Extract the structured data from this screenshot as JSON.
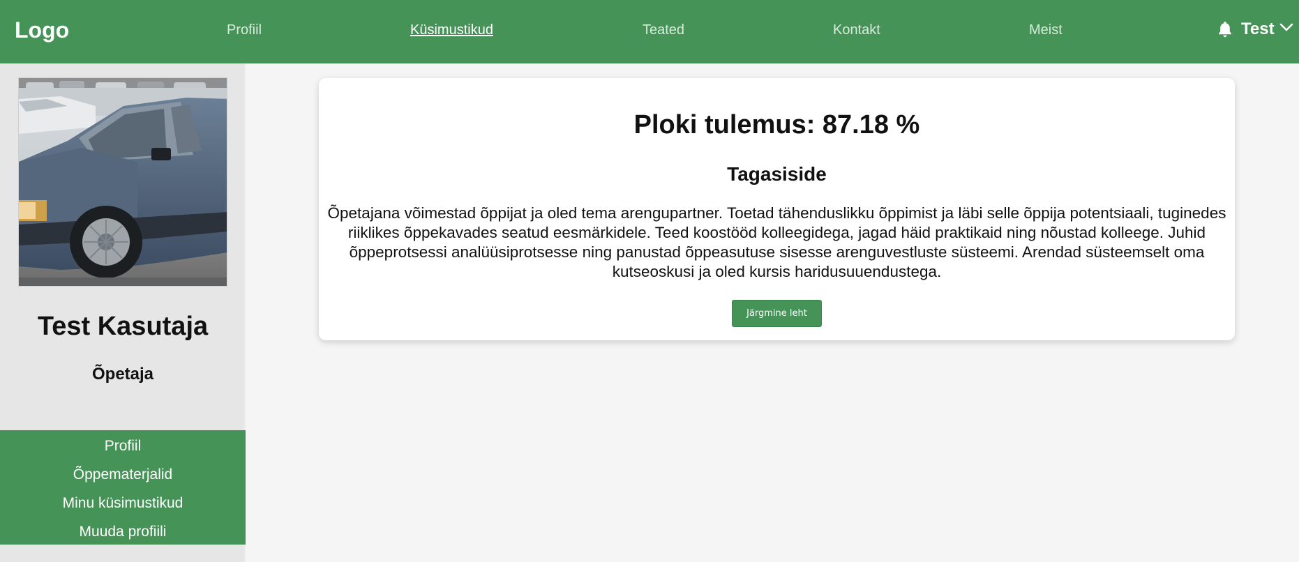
{
  "header": {
    "logo": "Logo",
    "nav": [
      {
        "label": "Profiil",
        "active": false
      },
      {
        "label": "Küsimustikud",
        "active": true
      },
      {
        "label": "Teated",
        "active": false
      },
      {
        "label": "Kontakt",
        "active": false
      },
      {
        "label": "Meist",
        "active": false
      }
    ],
    "user_label": "Test",
    "icons": {
      "notifications": "bell-icon",
      "user_menu": "chevron-down-icon"
    }
  },
  "sidebar": {
    "avatar_icon": "avatar",
    "name": "Test Kasutaja",
    "role": "Õpetaja",
    "menu": [
      {
        "label": "Profiil"
      },
      {
        "label": "Õppematerjalid"
      },
      {
        "label": "Minu küsimustikud"
      },
      {
        "label": "Muuda profiili"
      }
    ]
  },
  "result_card": {
    "title": "Ploki tulemus: 87.18 %",
    "feedback_heading": "Tagasiside",
    "feedback_text": "Õpetajana võimestad õppijat ja oled tema arengupartner. Toetad tähenduslikku õppimist ja läbi selle õppija potentsiaali, tuginedes riiklikes õppekavades seatud eesmärkidele. Teed koostööd kolleegidega, jagad häid praktikaid ning nõustad kolleege. Juhid õppeprotsessi analüüsiprotsesse ning panustad õppeasutuse sisesse arenguvestluste süsteemi. Arendad süsteemselt oma kutseoskusi ja oled kursis haridusuuendustega.",
    "next_button": "Järgmine leht"
  },
  "colors": {
    "brand_green": "#459357",
    "page_background": "#f5f5f5",
    "sidebar_background": "#e6e6e6"
  }
}
